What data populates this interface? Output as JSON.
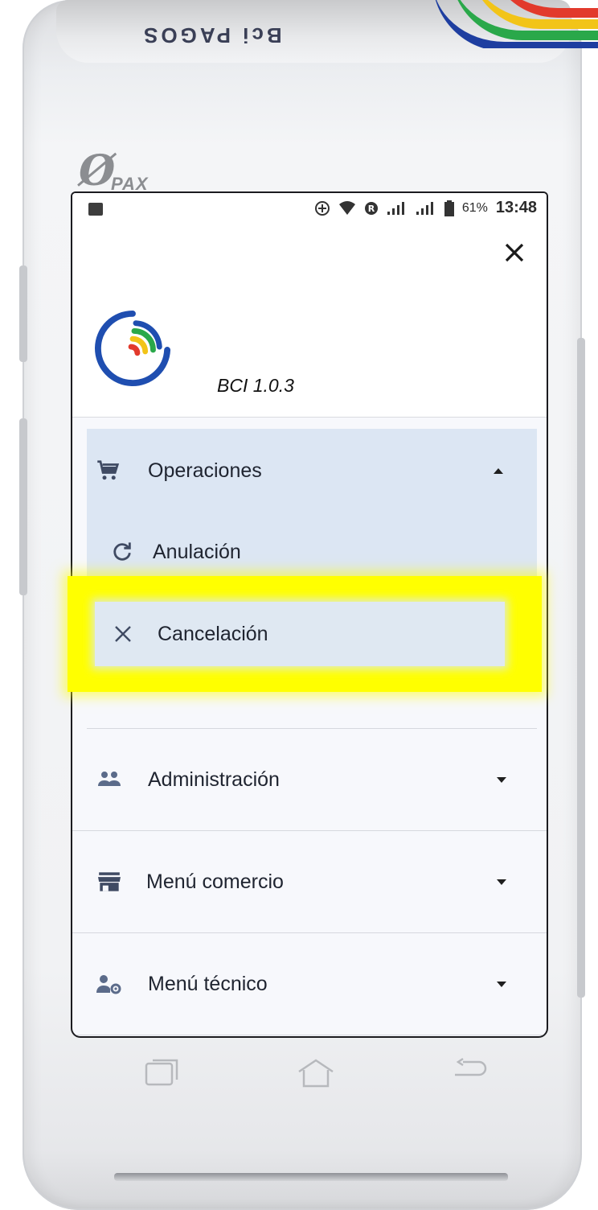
{
  "device": {
    "printer_brand": "Bci PAGOS",
    "maker_logo": "PAX"
  },
  "statusbar": {
    "battery_pct": "61%",
    "time": "13:48",
    "icons": [
      "image-icon",
      "add-circle-icon",
      "wifi-icon",
      "roaming-icon",
      "signal-icon",
      "signal-icon",
      "battery-icon"
    ]
  },
  "drawer": {
    "close_icon": "close-icon",
    "app_version": "BCI  1.0.3",
    "menu": {
      "operaciones": {
        "label": "Operaciones",
        "icon": "cart-icon",
        "expanded": true
      },
      "anulacion": {
        "label": "Anulación",
        "icon": "refresh-icon"
      },
      "cancelacion": {
        "label": "Cancelación",
        "icon": "close-icon"
      },
      "administracion": {
        "label": "Administración",
        "icon": "people-icon"
      },
      "menu_comercio": {
        "label": "Menú comercio",
        "icon": "store-icon"
      },
      "menu_tecnico": {
        "label": "Menú técnico",
        "icon": "user-settings-icon"
      }
    }
  },
  "colors": {
    "highlight": "#ffff00",
    "selected_group_bg": "#dce6f3",
    "icon": "#3f4a63",
    "logo_blue": "#1f4eb0"
  }
}
